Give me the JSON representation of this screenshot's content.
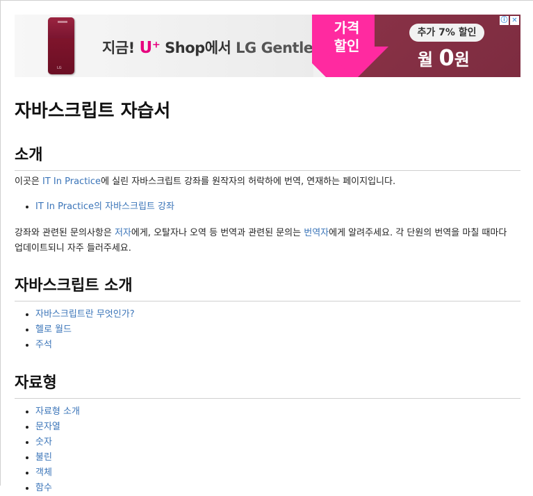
{
  "ad": {
    "slogan_prefix": "지금! ",
    "slogan_brand": "U⁺",
    "slogan_mid": "Shop에서 ",
    "slogan_product": "LG Gentle",
    "price_cut_line1": "가격",
    "price_cut_line2": "할인",
    "extra_discount": "추가 7% 할인",
    "monthly_prefix": "월 ",
    "monthly_zero": "0",
    "monthly_suffix": "원",
    "info_icon": "ⓘ",
    "close_icon": "✕",
    "colors": {
      "pink": "#ff2aa0",
      "maroon": "#7d2c40",
      "brand": "#e6007e"
    }
  },
  "page": {
    "title": "자바스크립트 자습서"
  },
  "intro": {
    "heading": "소개",
    "p1_prefix": "이곳은 ",
    "p1_link": "IT In Practice",
    "p1_suffix": "에 실린 자바스크립트 강좌를 원작자의 허락하에 번역, 연재하는 페이지입니다.",
    "list": [
      "IT In Practice의 자바스크립트 강좌"
    ],
    "p2_a": "강좌와 관련된 문의사항은 ",
    "p2_link1": "저자",
    "p2_b": "에게, 오탈자나 오역 등 번역과 관련된 문의는 ",
    "p2_link2": "번역자",
    "p2_c": "에게 알려주세요. 각 단원의 번역을 마칠 때마다",
    "p2_line2": "업데이트되니 자주 들러주세요."
  },
  "js_intro": {
    "heading": "자바스크립트 소개",
    "list": [
      "자바스크립트란 무엇인가?",
      "헬로 월드",
      "주석"
    ]
  },
  "types": {
    "heading": "자료형",
    "list": [
      "자료형 소개",
      "문자열",
      "숫자",
      "불린",
      "객체",
      "함수"
    ]
  }
}
